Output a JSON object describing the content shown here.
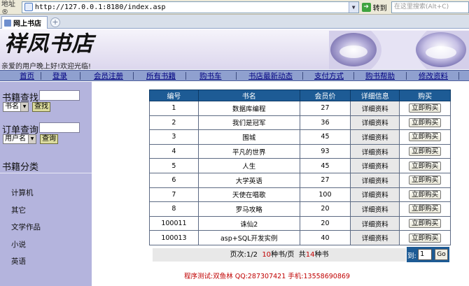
{
  "browser": {
    "address_label": "地址 ®",
    "url": "http://127.0.0.1:8180/index.asp",
    "go_label": "转到",
    "search_placeholder": "在这里搜索(Alt+C)",
    "tab_title": "网上书店"
  },
  "banner": {
    "logo_text": "祥凤书店",
    "welcome": "亲爱的用户晚上好!欢迎光临!"
  },
  "nav": {
    "items": [
      "首页",
      "登录",
      "会员注册",
      "所有书籍",
      "购书车",
      "书店最新动态",
      "支付方式",
      "购书帮助",
      "修改资料"
    ]
  },
  "sidebar": {
    "book_search_title": "书籍查找",
    "book_search_select": "书名",
    "book_search_button": "查找",
    "order_search_title": "订单查询",
    "order_search_select": "用户名",
    "order_search_button": "查询",
    "category_title": "书籍分类",
    "categories": [
      "计算机",
      "其它",
      "文学作品",
      "小说",
      "英语"
    ]
  },
  "table": {
    "headers": [
      "编号",
      "书名",
      "会员价",
      "详细信息",
      "购买"
    ],
    "detail_label": "详细资料",
    "buy_label": "立即购买",
    "rows": [
      {
        "id": "1",
        "title": "数据库编程",
        "price": "27"
      },
      {
        "id": "2",
        "title": "我们是冠军",
        "price": "36"
      },
      {
        "id": "3",
        "title": "围城",
        "price": "45"
      },
      {
        "id": "4",
        "title": "平凡的世界",
        "price": "93"
      },
      {
        "id": "5",
        "title": "人生",
        "price": "45"
      },
      {
        "id": "6",
        "title": "大学英语",
        "price": "27"
      },
      {
        "id": "7",
        "title": "天使在唱歌",
        "price": "100"
      },
      {
        "id": "8",
        "title": "罗马攻略",
        "price": "20"
      },
      {
        "id": "100011",
        "title": "诛仙2",
        "price": "20"
      },
      {
        "id": "100013",
        "title": "asp+SQL开发实例",
        "price": "40"
      }
    ]
  },
  "pager": {
    "page_label": "页次:",
    "page_value": "1/2",
    "per_page_value": "10",
    "per_page_label": "种书/页",
    "total_label": "共",
    "total_value": "14",
    "total_unit": "种书",
    "jump_label": "到:",
    "jump_value": "1",
    "go_label": "Go"
  },
  "footer": {
    "text": "程序测试:双鱼林 QQ:287307421 手机:13558690869"
  }
}
